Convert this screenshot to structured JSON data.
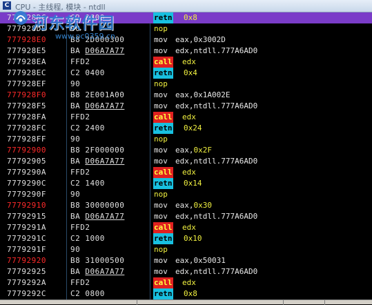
{
  "window": {
    "icon_letter": "C",
    "title": "CPU - 主线程, 模块 - ntdll"
  },
  "watermark": {
    "logo": "河东软件园 logo",
    "main": "河东软件园",
    "url": "www.pc0359.cn"
  },
  "colors": {
    "background": "#000000",
    "selected_row": "#7a3cc8",
    "jump_target_address": "#ff2a2a",
    "call_highlight": "#e02020",
    "retn_highlight": "#18c0e0",
    "constant": "#f0f040"
  },
  "rows": [
    {
      "addr": "777928DC",
      "target": false,
      "hex": [
        "C2 0800",
        ""
      ],
      "mnem": "retn",
      "kind": "retn",
      "ops": [
        {
          "t": "0x8",
          "num": true
        }
      ],
      "selected": true
    },
    {
      "addr": "777928DF",
      "target": false,
      "hex": [
        "90",
        ""
      ],
      "mnem": "nop",
      "kind": "nop",
      "ops": []
    },
    {
      "addr": "777928E0",
      "target": true,
      "hex": [
        "B8 2D000300",
        ""
      ],
      "mnem": "mov",
      "kind": "mov",
      "ops": [
        {
          "t": "eax,0x3002D",
          "num": false
        }
      ]
    },
    {
      "addr": "777928E5",
      "target": false,
      "hex": [
        "BA ",
        "D06A7A77"
      ],
      "mnem": "mov",
      "kind": "mov",
      "ops": [
        {
          "t": "edx,ntdll.777A6AD0",
          "num": false
        }
      ]
    },
    {
      "addr": "777928EA",
      "target": false,
      "hex": [
        "FFD2",
        ""
      ],
      "mnem": "call",
      "kind": "call",
      "ops": [
        {
          "t": "edx",
          "num": true
        }
      ]
    },
    {
      "addr": "777928EC",
      "target": false,
      "hex": [
        "C2 0400",
        ""
      ],
      "mnem": "retn",
      "kind": "retn",
      "ops": [
        {
          "t": "0x4",
          "num": true
        }
      ]
    },
    {
      "addr": "777928EF",
      "target": false,
      "hex": [
        "90",
        ""
      ],
      "mnem": "nop",
      "kind": "nop",
      "ops": []
    },
    {
      "addr": "777928F0",
      "target": true,
      "hex": [
        "B8 2E001A00",
        ""
      ],
      "mnem": "mov",
      "kind": "mov",
      "ops": [
        {
          "t": "eax,0x1A002E",
          "num": false
        }
      ]
    },
    {
      "addr": "777928F5",
      "target": false,
      "hex": [
        "BA ",
        "D06A7A77"
      ],
      "mnem": "mov",
      "kind": "mov",
      "ops": [
        {
          "t": "edx,ntdll.777A6AD0",
          "num": false
        }
      ]
    },
    {
      "addr": "777928FA",
      "target": false,
      "hex": [
        "FFD2",
        ""
      ],
      "mnem": "call",
      "kind": "call",
      "ops": [
        {
          "t": "edx",
          "num": true
        }
      ]
    },
    {
      "addr": "777928FC",
      "target": false,
      "hex": [
        "C2 2400",
        ""
      ],
      "mnem": "retn",
      "kind": "retn",
      "ops": [
        {
          "t": "0x24",
          "num": true
        }
      ]
    },
    {
      "addr": "777928FF",
      "target": false,
      "hex": [
        "90",
        ""
      ],
      "mnem": "nop",
      "kind": "nop",
      "ops": []
    },
    {
      "addr": "77792900",
      "target": true,
      "hex": [
        "B8 2F000000",
        ""
      ],
      "mnem": "mov",
      "kind": "mov",
      "ops": [
        {
          "t": "eax,",
          "num": false
        },
        {
          "t": "0x2F",
          "num": true
        }
      ]
    },
    {
      "addr": "77792905",
      "target": false,
      "hex": [
        "BA ",
        "D06A7A77"
      ],
      "mnem": "mov",
      "kind": "mov",
      "ops": [
        {
          "t": "edx,ntdll.777A6AD0",
          "num": false
        }
      ]
    },
    {
      "addr": "7779290A",
      "target": false,
      "hex": [
        "FFD2",
        ""
      ],
      "mnem": "call",
      "kind": "call",
      "ops": [
        {
          "t": "edx",
          "num": true
        }
      ]
    },
    {
      "addr": "7779290C",
      "target": false,
      "hex": [
        "C2 1400",
        ""
      ],
      "mnem": "retn",
      "kind": "retn",
      "ops": [
        {
          "t": "0x14",
          "num": true
        }
      ]
    },
    {
      "addr": "7779290F",
      "target": false,
      "hex": [
        "90",
        ""
      ],
      "mnem": "nop",
      "kind": "nop",
      "ops": []
    },
    {
      "addr": "77792910",
      "target": true,
      "hex": [
        "B8 30000000",
        ""
      ],
      "mnem": "mov",
      "kind": "mov",
      "ops": [
        {
          "t": "eax,",
          "num": false
        },
        {
          "t": "0x30",
          "num": true
        }
      ]
    },
    {
      "addr": "77792915",
      "target": false,
      "hex": [
        "BA ",
        "D06A7A77"
      ],
      "mnem": "mov",
      "kind": "mov",
      "ops": [
        {
          "t": "edx,ntdll.777A6AD0",
          "num": false
        }
      ]
    },
    {
      "addr": "7779291A",
      "target": false,
      "hex": [
        "FFD2",
        ""
      ],
      "mnem": "call",
      "kind": "call",
      "ops": [
        {
          "t": "edx",
          "num": true
        }
      ]
    },
    {
      "addr": "7779291C",
      "target": false,
      "hex": [
        "C2 1000",
        ""
      ],
      "mnem": "retn",
      "kind": "retn",
      "ops": [
        {
          "t": "0x10",
          "num": true
        }
      ]
    },
    {
      "addr": "7779291F",
      "target": false,
      "hex": [
        "90",
        ""
      ],
      "mnem": "nop",
      "kind": "nop",
      "ops": []
    },
    {
      "addr": "77792920",
      "target": true,
      "hex": [
        "B8 31000500",
        ""
      ],
      "mnem": "mov",
      "kind": "mov",
      "ops": [
        {
          "t": "eax,0x50031",
          "num": false
        }
      ]
    },
    {
      "addr": "77792925",
      "target": false,
      "hex": [
        "BA ",
        "D06A7A77"
      ],
      "mnem": "mov",
      "kind": "mov",
      "ops": [
        {
          "t": "edx,ntdll.777A6AD0",
          "num": false
        }
      ]
    },
    {
      "addr": "7779292A",
      "target": false,
      "hex": [
        "FFD2",
        ""
      ],
      "mnem": "call",
      "kind": "call",
      "ops": [
        {
          "t": "edx",
          "num": true
        }
      ]
    },
    {
      "addr": "7779292C",
      "target": false,
      "hex": [
        "C2 0800",
        ""
      ],
      "mnem": "retn",
      "kind": "retn",
      "ops": [
        {
          "t": "0x8",
          "num": true
        }
      ]
    }
  ]
}
